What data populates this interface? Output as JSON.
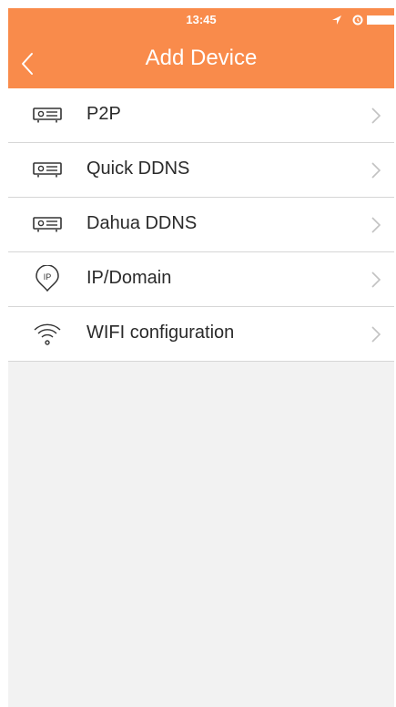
{
  "status_bar": {
    "time": "13:45",
    "icons": [
      "location-arrow-icon",
      "alarm-icon",
      "battery-icon"
    ]
  },
  "header": {
    "title": "Add Device",
    "back_icon": "chevron-left-icon",
    "background_color": "#f98b4b"
  },
  "menu": {
    "items": [
      {
        "label": "P2P",
        "icon": "dvr-device-icon"
      },
      {
        "label": "Quick DDNS",
        "icon": "dvr-device-icon"
      },
      {
        "label": "Dahua DDNS",
        "icon": "dvr-device-icon"
      },
      {
        "label": "IP/Domain",
        "icon": "ip-pin-icon"
      },
      {
        "label": "WIFI configuration",
        "icon": "wifi-icon"
      }
    ],
    "chevron_icon": "chevron-right-icon"
  }
}
